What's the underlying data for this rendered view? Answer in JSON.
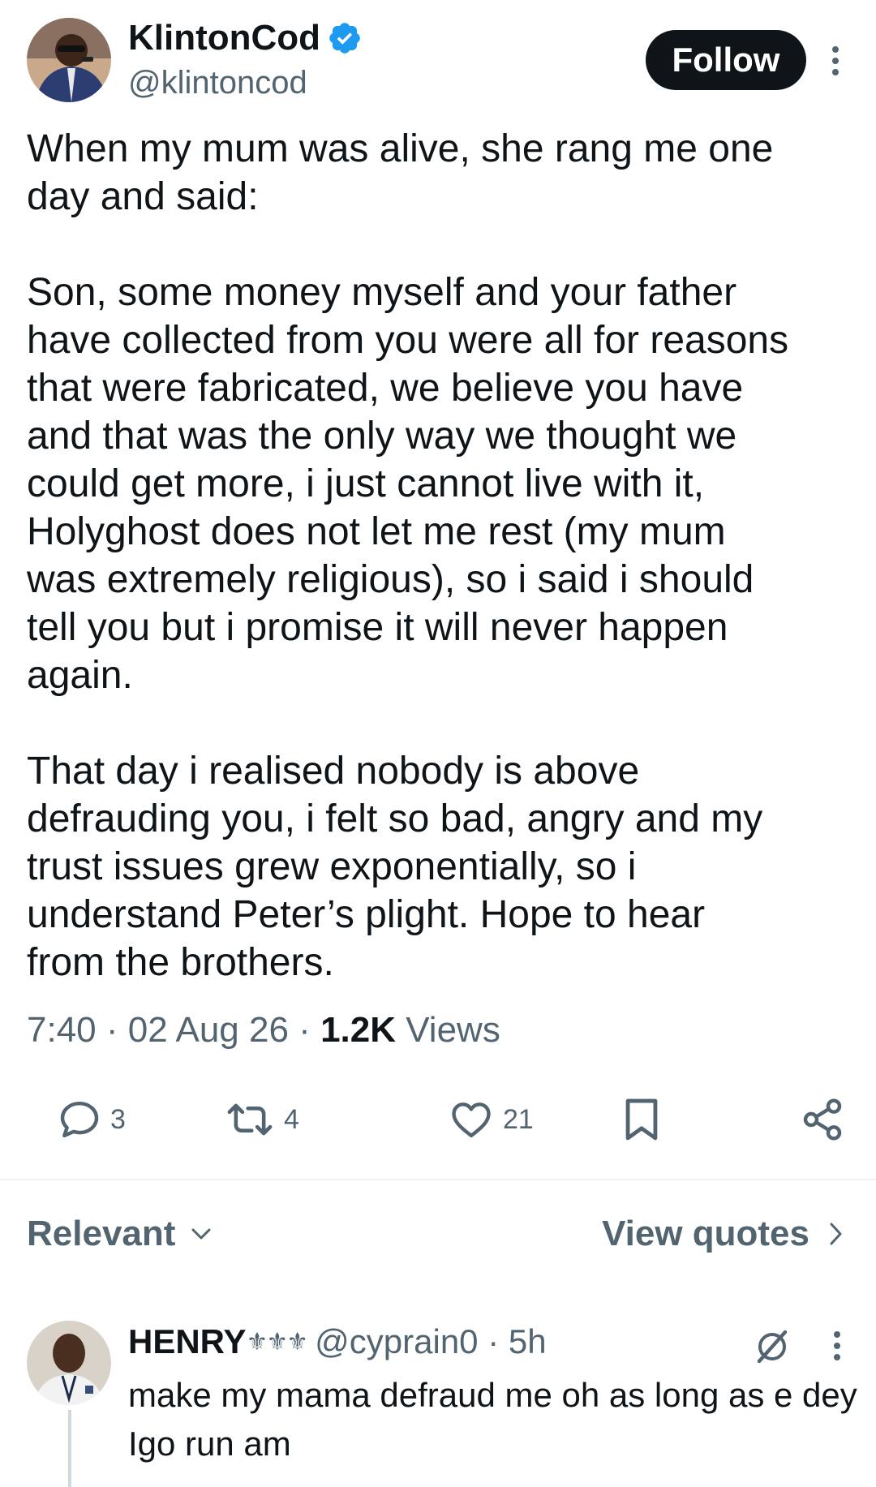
{
  "header": {
    "display_name": "KlintonCod",
    "handle": "@klintoncod",
    "follow_label": "Follow",
    "verified_icon": "verified-badge-icon",
    "accent_color": "#1d9bf0"
  },
  "tweet": {
    "text": "When my mum was alive, she rang me one\nday and said:\n\nSon, some money myself and your father\nhave collected from you were all for reasons\nthat were fabricated, we believe you have\nand that was the only way we thought we\ncould get more, i just cannot live with it,\nHolyghost does not let me rest (my mum\nwas extremely religious), so i said i should\ntell you but i promise it will never happen\nagain.\n\nThat day i realised nobody is above\ndefrauding you, i felt so bad, angry and my\ntrust issues grew exponentially, so i\nunderstand Peter’s plight. Hope to hear\nfrom the brothers.",
    "time": "7:40",
    "date": "02 Aug 26",
    "views_count": "1.2K",
    "views_label": "Views"
  },
  "actions": {
    "replies": "3",
    "reposts": "4",
    "likes": "21"
  },
  "filters": {
    "sort_label": "Relevant",
    "quotes_label": "View quotes"
  },
  "reply": {
    "name": "HENRY",
    "emoji": "⚜⚜⚜",
    "handle": "@cyprain0",
    "time": "5h",
    "text": "make my mama defraud me oh as long as e dey Igo run am"
  }
}
